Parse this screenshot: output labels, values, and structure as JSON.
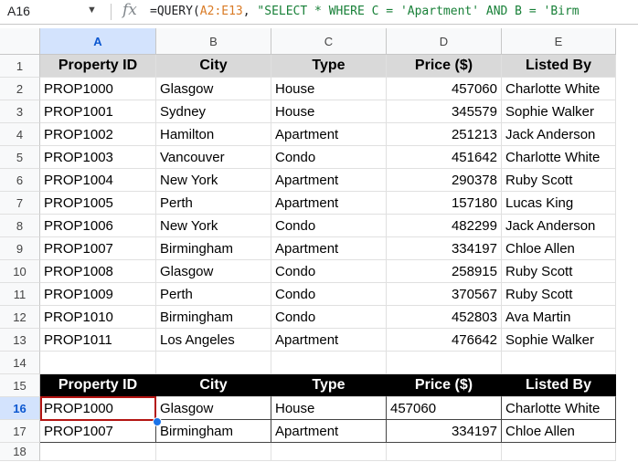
{
  "formula_bar": {
    "name_box": "A16",
    "formula_prefix": "=QUERY(",
    "formula_range": "A2:E13",
    "formula_sep": ", ",
    "formula_string": "\"SELECT * WHERE C = 'Apartment' AND B = 'Birm"
  },
  "columns": [
    "A",
    "B",
    "C",
    "D",
    "E"
  ],
  "rows": [
    "1",
    "2",
    "3",
    "4",
    "5",
    "6",
    "7",
    "8",
    "9",
    "10",
    "11",
    "12",
    "13",
    "14",
    "15",
    "16",
    "17",
    "18"
  ],
  "table_headers": [
    "Property ID",
    "City",
    "Type",
    "Price ($)",
    "Listed By"
  ],
  "table_rows": [
    [
      "PROP1000",
      "Glasgow",
      "House",
      "457060",
      "Charlotte White"
    ],
    [
      "PROP1001",
      "Sydney",
      "House",
      "345579",
      "Sophie Walker"
    ],
    [
      "PROP1002",
      "Hamilton",
      "Apartment",
      "251213",
      "Jack Anderson"
    ],
    [
      "PROP1003",
      "Vancouver",
      "Condo",
      "451642",
      "Charlotte White"
    ],
    [
      "PROP1004",
      "New York",
      "Apartment",
      "290378",
      "Ruby Scott"
    ],
    [
      "PROP1005",
      "Perth",
      "Apartment",
      "157180",
      "Lucas King"
    ],
    [
      "PROP1006",
      "New York",
      "Condo",
      "482299",
      "Jack Anderson"
    ],
    [
      "PROP1007",
      "Birmingham",
      "Apartment",
      "334197",
      "Chloe Allen"
    ],
    [
      "PROP1008",
      "Glasgow",
      "Condo",
      "258915",
      "Ruby Scott"
    ],
    [
      "PROP1009",
      "Perth",
      "Condo",
      "370567",
      "Ruby Scott"
    ],
    [
      "PROP1010",
      "Birmingham",
      "Condo",
      "452803",
      "Ava Martin"
    ],
    [
      "PROP1011",
      "Los Angeles",
      "Apartment",
      "476642",
      "Sophie Walker"
    ]
  ],
  "result_headers": [
    "Property ID",
    "City",
    "Type",
    "Price ($)",
    "Listed By"
  ],
  "result_rows": [
    [
      "PROP1000",
      "Glasgow",
      "House",
      "457060",
      "Charlotte White"
    ],
    [
      "PROP1007",
      "Birmingham",
      "Apartment",
      "334197",
      "Chloe Allen"
    ]
  ],
  "colors": {
    "header_gray": "#d9d9d9",
    "header_black": "#000000",
    "selection": "#b31412"
  }
}
